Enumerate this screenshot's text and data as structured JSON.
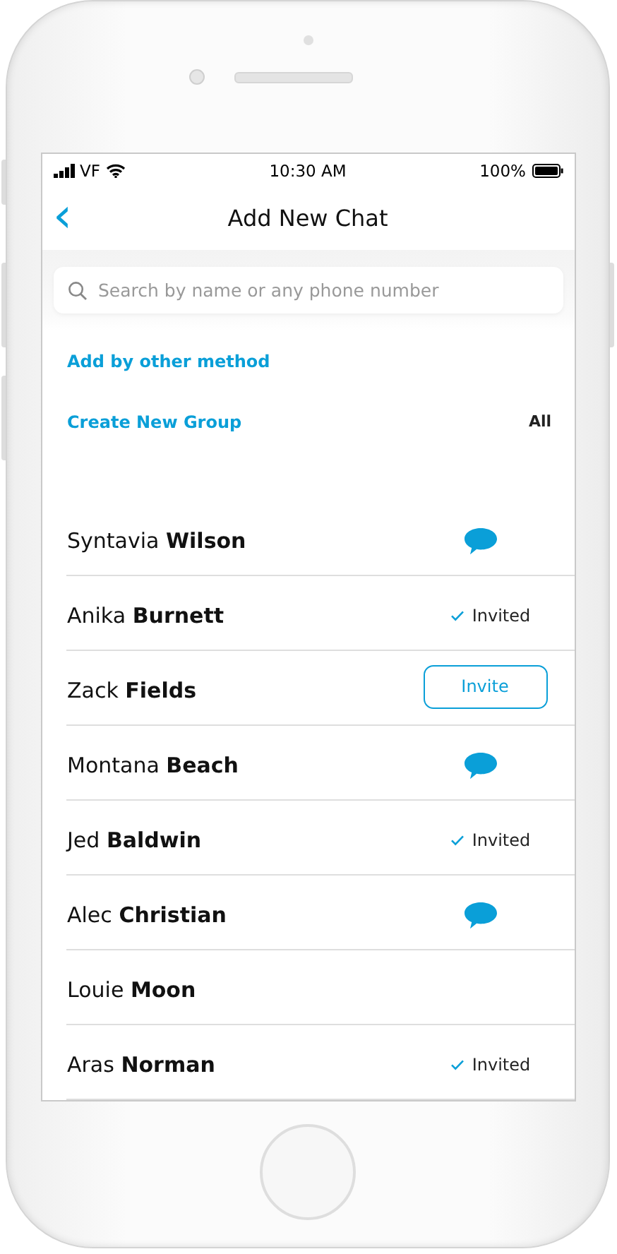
{
  "status_bar": {
    "carrier": "VF",
    "time": "10:30 AM",
    "battery": "100%"
  },
  "header": {
    "back": "‹",
    "title": "Add New Chat"
  },
  "search": {
    "placeholder": "Search by name or any phone number"
  },
  "links": [
    {
      "label": "Add by other method"
    },
    {
      "label": "Create New Group",
      "filter": "All"
    }
  ],
  "contacts": [
    {
      "first": "Syntavia",
      "last": "Wilson",
      "kind": "chat"
    },
    {
      "first": "Anika",
      "last": "Burnett",
      "kind": "invited",
      "label": "Invited"
    },
    {
      "first": "Zack",
      "last": "Fields",
      "kind": "invite",
      "label": "Invite"
    },
    {
      "first": "Montana",
      "last": "Beach",
      "kind": "chat"
    },
    {
      "first": "Jed",
      "last": "Baldwin",
      "kind": "invited",
      "label": "Invited"
    },
    {
      "first": "Alec",
      "last": "Christian",
      "kind": "chat"
    },
    {
      "first": "Louie",
      "last": "Moon",
      "kind": "none"
    },
    {
      "first": "Aras",
      "last": "Norman",
      "kind": "invited",
      "label": "Invited"
    }
  ]
}
